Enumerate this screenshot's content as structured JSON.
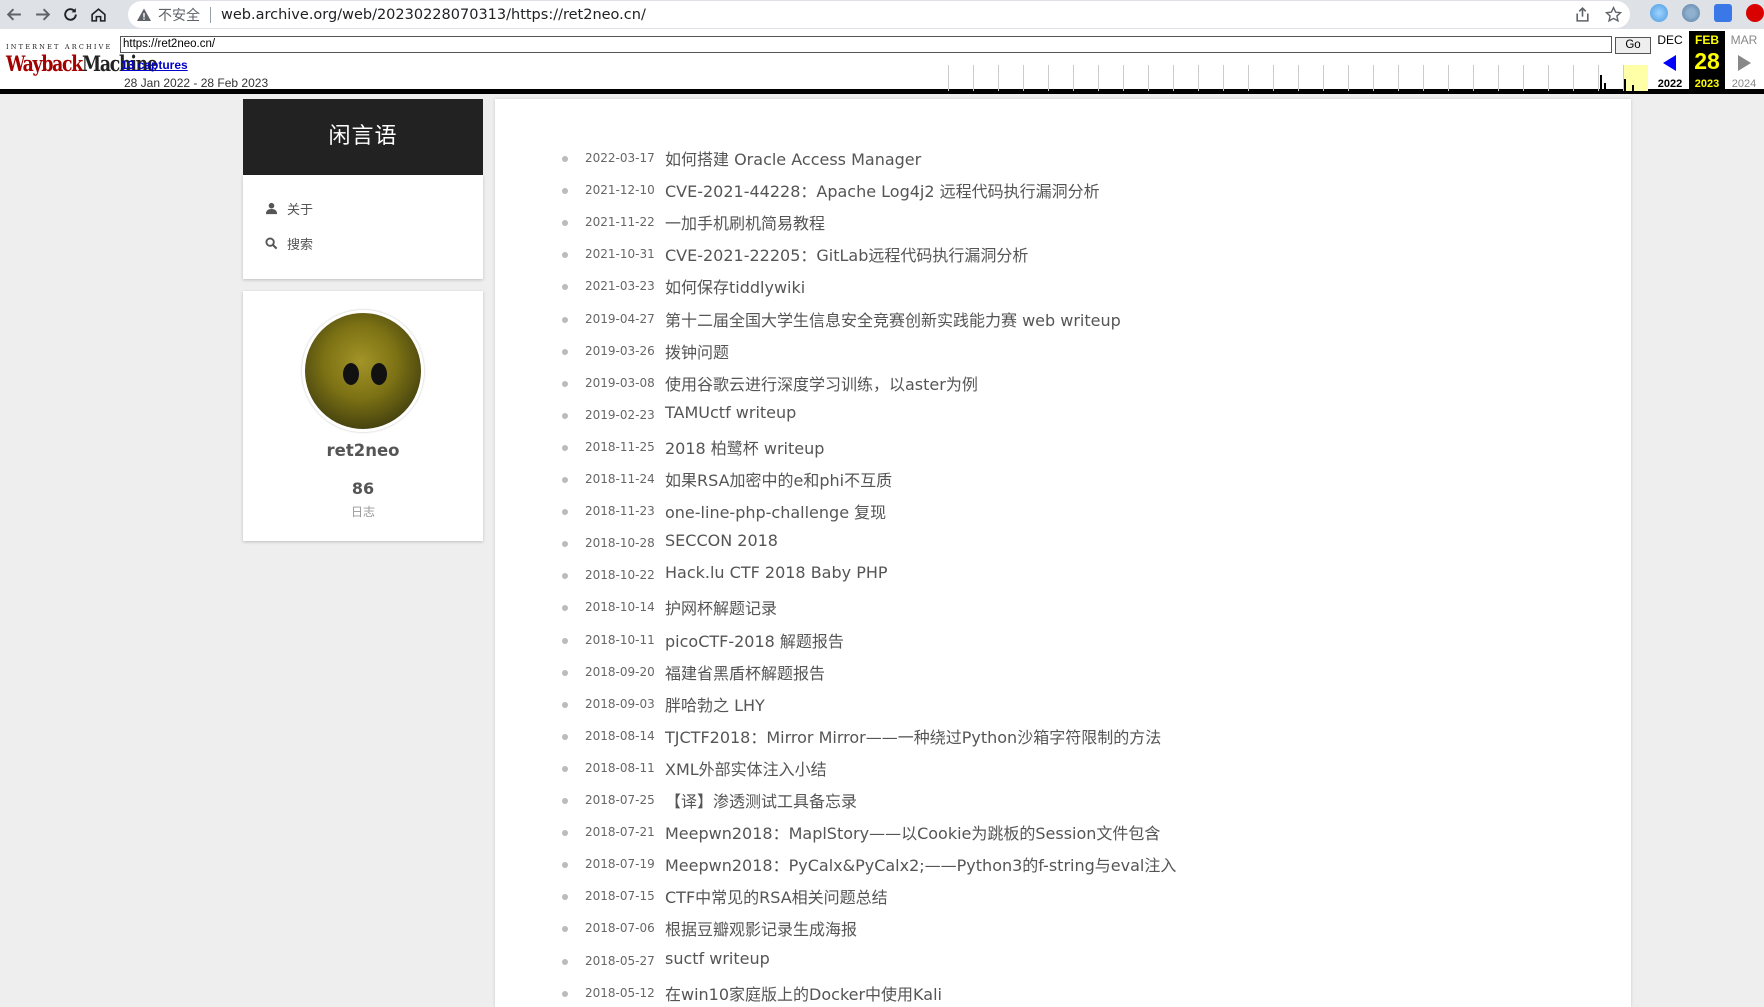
{
  "browser": {
    "insecure_label": "不安全",
    "url": "web.archive.org/web/20230228070313/https://ret2neo.cn/"
  },
  "wayback": {
    "logo_top": "INTERNET ARCHIVE",
    "logo_wordmark_a": "Wayback",
    "logo_wordmark_b": "Machine",
    "url_input": "https://ret2neo.cn/",
    "go_label": "Go",
    "captures": "13 captures",
    "range": "28 Jan 2022 - 28 Feb 2023",
    "prev_month": "DEC",
    "prev_year": "2022",
    "cur_month": "FEB",
    "cur_day": "28",
    "cur_year": "2023",
    "next_month": "MAR",
    "next_year": "2024"
  },
  "sidebar": {
    "site_title": "闲言语",
    "menu": [
      {
        "label": "关于",
        "icon": "user-icon"
      },
      {
        "label": "搜索",
        "icon": "search-icon"
      }
    ],
    "profile": {
      "name": "ret2neo",
      "post_count": "86",
      "post_label": "日志"
    }
  },
  "posts": [
    {
      "date": "2022-03-17",
      "title": "如何搭建 Oracle Access Manager"
    },
    {
      "date": "2021-12-10",
      "title": "CVE-2021-44228：Apache Log4j2 远程代码执行漏洞分析"
    },
    {
      "date": "2021-11-22",
      "title": "一加手机刷机简易教程"
    },
    {
      "date": "2021-10-31",
      "title": "CVE-2021-22205：GitLab远程代码执行漏洞分析"
    },
    {
      "date": "2021-03-23",
      "title": "如何保存tiddlywiki"
    },
    {
      "date": "2019-04-27",
      "title": "第十二届全国大学生信息安全竞赛创新实践能力赛 web writeup"
    },
    {
      "date": "2019-03-26",
      "title": "拨钟问题"
    },
    {
      "date": "2019-03-08",
      "title": "使用谷歌云进行深度学习训练，以aster为例"
    },
    {
      "date": "2019-02-23",
      "title": "TAMUctf writeup"
    },
    {
      "date": "2018-11-25",
      "title": "2018 柏鹭杯 writeup"
    },
    {
      "date": "2018-11-24",
      "title": "如果RSA加密中的e和phi不互质"
    },
    {
      "date": "2018-11-23",
      "title": "one-line-php-challenge 复现"
    },
    {
      "date": "2018-10-28",
      "title": "SECCON 2018"
    },
    {
      "date": "2018-10-22",
      "title": "Hack.lu CTF 2018 Baby PHP"
    },
    {
      "date": "2018-10-14",
      "title": "护网杯解题记录"
    },
    {
      "date": "2018-10-11",
      "title": "picoCTF-2018 解题报告"
    },
    {
      "date": "2018-09-20",
      "title": "福建省黑盾杯解题报告"
    },
    {
      "date": "2018-09-03",
      "title": "胖哈勃之 LHY"
    },
    {
      "date": "2018-08-14",
      "title": "TJCTF2018：Mirror Mirror——一种绕过Python沙箱字符限制的方法"
    },
    {
      "date": "2018-08-11",
      "title": "XML外部实体注入小结"
    },
    {
      "date": "2018-07-25",
      "title": "【译】渗透测试工具备忘录"
    },
    {
      "date": "2018-07-21",
      "title": "Meepwn2018：MaplStory——以Cookie为跳板的Session文件包含"
    },
    {
      "date": "2018-07-19",
      "title": "Meepwn2018：PyCalx&PyCalx2;——Python3的f-string与eval注入"
    },
    {
      "date": "2018-07-15",
      "title": "CTF中常见的RSA相关问题总结"
    },
    {
      "date": "2018-07-06",
      "title": "根据豆瓣观影记录生成海报"
    },
    {
      "date": "2018-05-27",
      "title": "suctf writeup"
    },
    {
      "date": "2018-05-12",
      "title": "在win10家庭版上的Docker中使用Kali"
    }
  ]
}
